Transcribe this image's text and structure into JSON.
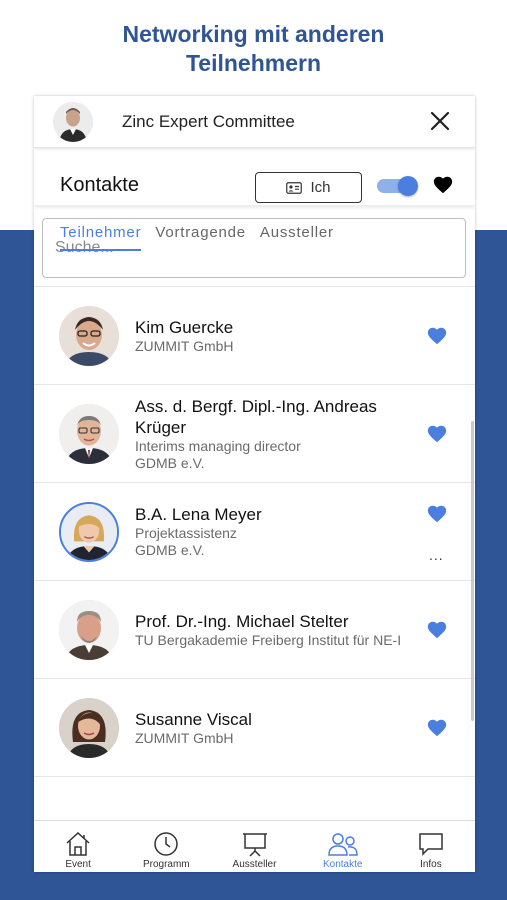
{
  "promo": {
    "line1": "Networking mit anderen",
    "line2": "Teilnehmern"
  },
  "topbar": {
    "event_name": "Zinc Expert Committee"
  },
  "header": {
    "title": "Kontakte",
    "me_button": "Ich"
  },
  "tabs": [
    {
      "label": "Teilnehmer",
      "active": true
    },
    {
      "label": "Vortragende",
      "active": false
    },
    {
      "label": "Aussteller",
      "active": false
    }
  ],
  "search": {
    "placeholder": "Suche..."
  },
  "contacts": [
    {
      "name": "Kim Guercke",
      "line1": "ZUMMIT GmbH",
      "line2": ""
    },
    {
      "name": "Ass. d. Bergf. Dipl.-Ing. Andreas Krüger",
      "line1": "Interims managing director",
      "line2": "GDMB e.V."
    },
    {
      "name": "B.A. Lena Meyer",
      "line1": "Projektassistenz",
      "line2": "GDMB e.V."
    },
    {
      "name": "Prof. Dr.-Ing. Michael Stelter",
      "line1": "TU Bergakademie Freiberg Institut für NE-I",
      "line2": ""
    },
    {
      "name": "Susanne Viscal",
      "line1": "ZUMMIT GmbH",
      "line2": ""
    }
  ],
  "more_label": "...",
  "nav": [
    {
      "label": "Event",
      "icon": "home-icon"
    },
    {
      "label": "Programm",
      "icon": "clock-icon"
    },
    {
      "label": "Aussteller",
      "icon": "presentation-icon"
    },
    {
      "label": "Kontakte",
      "icon": "people-icon",
      "active": true
    },
    {
      "label": "Infos",
      "icon": "chat-icon"
    }
  ],
  "colors": {
    "brand_blue": "#2f5597",
    "accent": "#4a7fe0"
  }
}
